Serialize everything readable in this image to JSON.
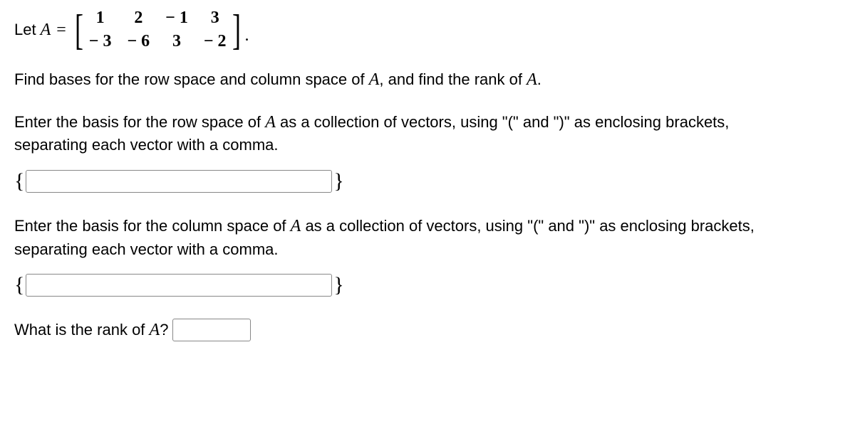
{
  "matrix_def": {
    "prefix": "Let ",
    "var": "A",
    "equals": "=",
    "cells": [
      "1",
      "2",
      "− 1",
      "3",
      "− 3",
      "− 6",
      "3",
      "− 2"
    ],
    "period": "."
  },
  "instruction_main": {
    "p1": "Find bases for the row space and column space of ",
    "v1": "A",
    "p2": ", and find the rank of ",
    "v2": "A",
    "p3": "."
  },
  "row_space": {
    "p1": "Enter the basis for the row space of ",
    "v1": "A",
    "p2": " as a collection of vectors, using \"(\" and \")\" as enclosing brackets, separating each vector with a comma."
  },
  "col_space": {
    "p1": "Enter the basis for the column space of ",
    "v1": "A",
    "p2": " as a collection of vectors, using \"(\" and \")\" as enclosing brackets, separating each vector with a comma."
  },
  "rank": {
    "p1": "What is the rank of ",
    "v1": "A",
    "p2": "?"
  },
  "braces": {
    "left": "{",
    "right": "}"
  },
  "inputs": {
    "row_value": "",
    "col_value": "",
    "rank_value": ""
  }
}
